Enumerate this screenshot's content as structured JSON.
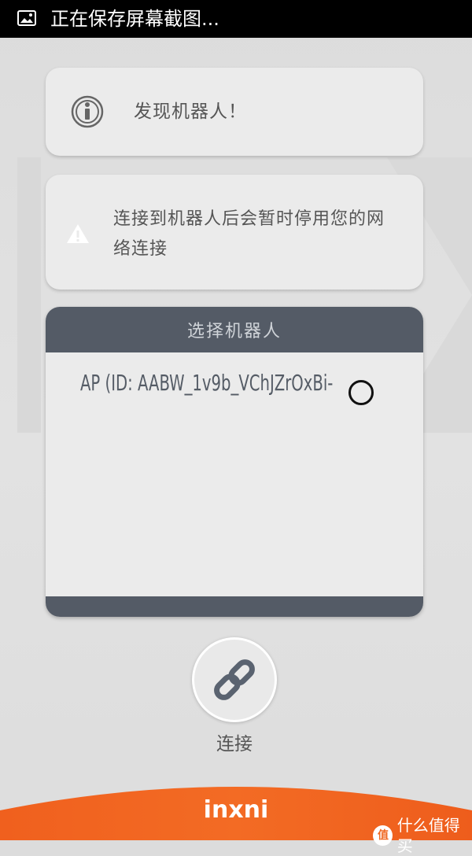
{
  "statusbar": {
    "text": "正在保存屏幕截图..."
  },
  "notice_found": {
    "text": "发现机器人！"
  },
  "notice_network": {
    "text": "连接到机器人后会暂时停用您的网络连接"
  },
  "robot_panel": {
    "title": "选择机器人",
    "robots": [
      {
        "name": "AP (ID: AABW_1v9b_VChJZrOxBi-",
        "selected": false
      }
    ]
  },
  "connect": {
    "label": "连接",
    "icon": "link-icon"
  },
  "footer": {
    "brand": "inxni",
    "source": "什么值得买",
    "source_icon_text": "值"
  },
  "colors": {
    "panel_header": "#545b66",
    "accent": "#f06a24"
  }
}
